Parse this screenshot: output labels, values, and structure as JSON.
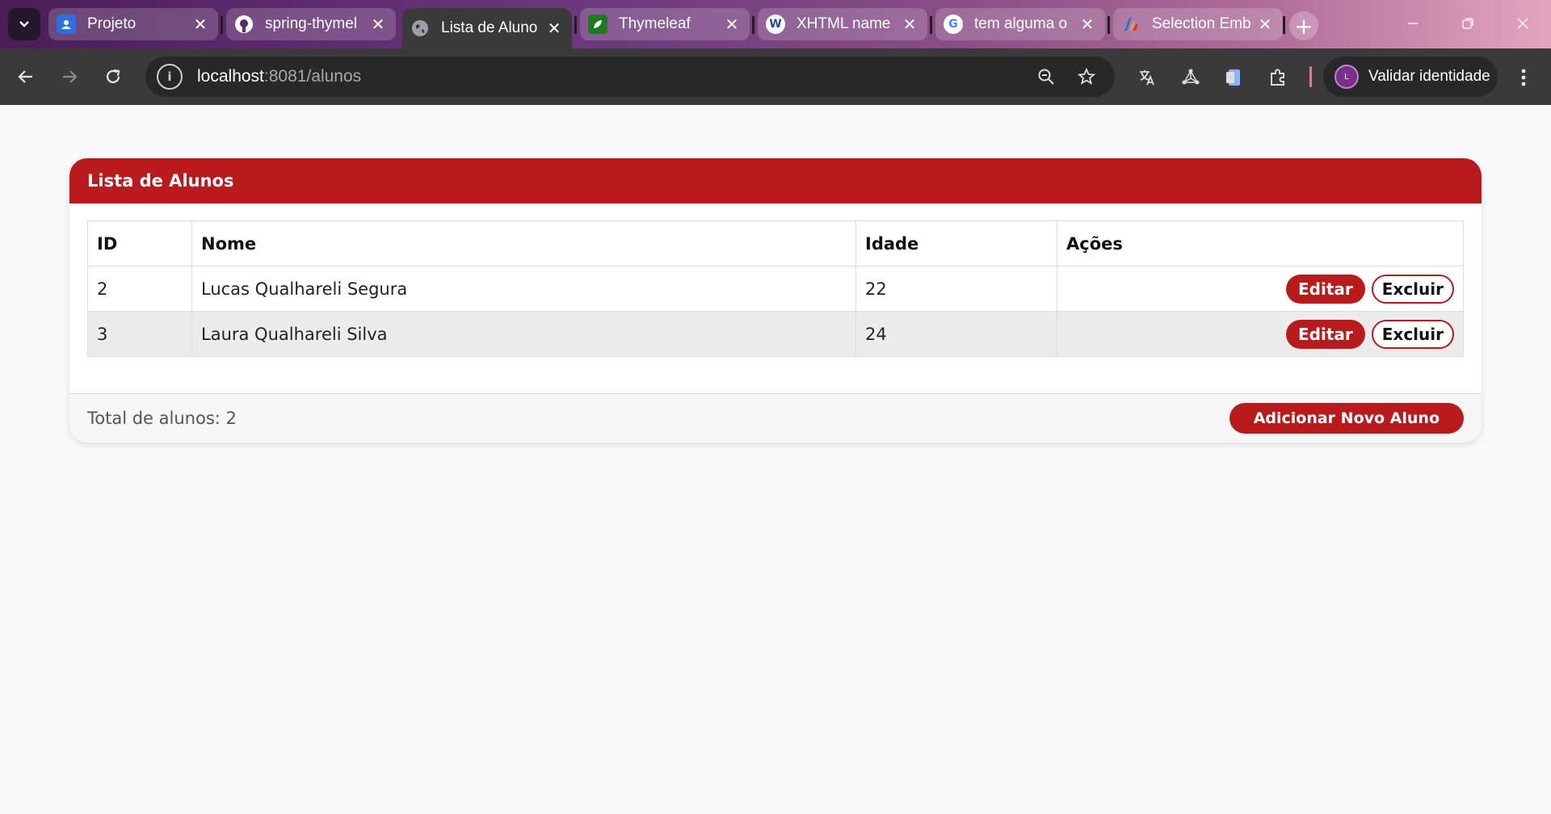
{
  "browser": {
    "tabs": [
      {
        "title": "Projeto",
        "favicon": "google-classroom-icon",
        "favicon_color": "#2f6ee0",
        "active": false
      },
      {
        "title": "spring-thymel",
        "favicon": "github-icon",
        "favicon_color": "#ffffff",
        "active": false
      },
      {
        "title": "Lista de Aluno",
        "favicon": "globe-icon",
        "favicon_color": "#9aa0a6",
        "active": true
      },
      {
        "title": "Thymeleaf",
        "favicon": "thymeleaf-leaf-icon",
        "favicon_color": "#1f7a1f",
        "active": false
      },
      {
        "title": "XHTML name",
        "favicon": "w3c-icon",
        "favicon_color": "#ffffff",
        "active": false
      },
      {
        "title": "tem alguma o",
        "favicon": "google-icon",
        "favicon_color": "#ffffff",
        "active": false
      },
      {
        "title": "Selection Emb",
        "favicon": "adobe-analytics-icon",
        "favicon_color": "#e4a23a",
        "active": false
      }
    ],
    "url_host": "localhost",
    "url_rest": ":8081/alunos",
    "profile_label": "Validar identidade",
    "profile_initial": "L"
  },
  "card": {
    "title": "Lista de Alunos",
    "columns": [
      "ID",
      "Nome",
      "Idade",
      "Ações"
    ],
    "rows": [
      {
        "id": "2",
        "nome": "Lucas Qualhareli Segura",
        "idade": "22"
      },
      {
        "id": "3",
        "nome": "Laura Qualhareli Silva",
        "idade": "24"
      }
    ],
    "edit_label": "Editar",
    "delete_label": "Excluir",
    "total_label": "Total de alunos: 2",
    "add_label": "Adicionar Novo Aluno"
  },
  "colors": {
    "accent": "#bb1a1d",
    "page_bg": "#f8f9fb"
  }
}
